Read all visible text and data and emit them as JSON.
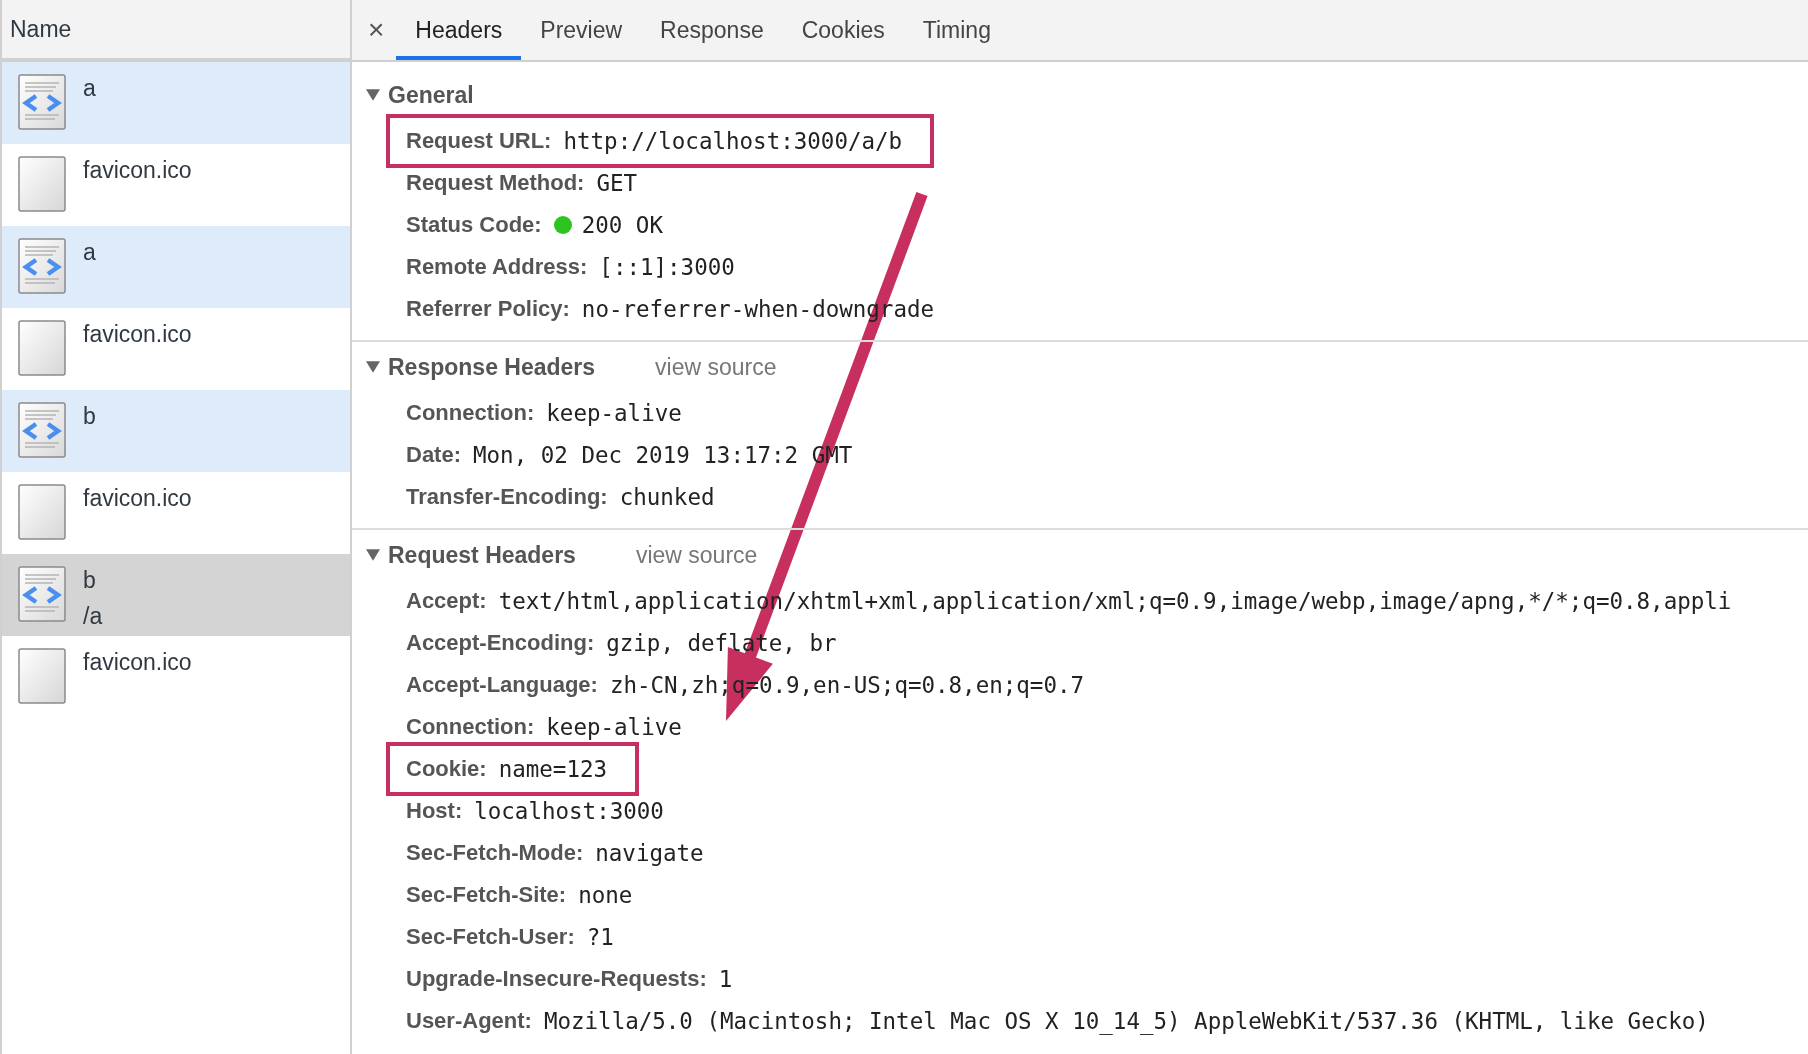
{
  "requests_list": {
    "header": "Name",
    "items": [
      {
        "kind": "document",
        "name": "a",
        "selected": false
      },
      {
        "kind": "file",
        "name": "favicon.ico",
        "selected": false
      },
      {
        "kind": "document",
        "name": "a",
        "selected": false
      },
      {
        "kind": "file",
        "name": "favicon.ico",
        "selected": false
      },
      {
        "kind": "document",
        "name": "b",
        "selected": false
      },
      {
        "kind": "file",
        "name": "favicon.ico",
        "selected": false
      },
      {
        "kind": "document",
        "name": "b",
        "path": "/a",
        "selected": true
      },
      {
        "kind": "file",
        "name": "favicon.ico",
        "selected": false
      }
    ]
  },
  "tabs": {
    "close": "×",
    "items": [
      {
        "label": "Headers",
        "selected": true
      },
      {
        "label": "Preview",
        "selected": false
      },
      {
        "label": "Response",
        "selected": false
      },
      {
        "label": "Cookies",
        "selected": false
      },
      {
        "label": "Timing",
        "selected": false
      }
    ]
  },
  "sections": [
    {
      "title": "General",
      "expanded": true,
      "rows": [
        {
          "name": "Request URL:",
          "value": "http://localhost:3000/a/b",
          "highlighted": true
        },
        {
          "name": "Request Method:",
          "value": "GET",
          "highlighted": false
        },
        {
          "name": "Status Code:",
          "value": "200 OK",
          "color": "#2ec41f",
          "highlighted": false
        },
        {
          "name": "Remote Address:",
          "value": "[::1]:3000",
          "highlighted": false
        },
        {
          "name": "Referrer Policy:",
          "value": "no-referrer-when-downgrade",
          "highlighted": false
        }
      ]
    },
    {
      "title": "Response Headers",
      "link": "view source",
      "expanded": true,
      "rows": [
        {
          "name": "Connection:",
          "value": "keep-alive",
          "highlighted": false
        },
        {
          "name": "Date:",
          "value": "Mon, 02 Dec 2019 13:17:2  GMT",
          "highlighted": false
        },
        {
          "name": "Transfer-Encoding:",
          "value": "chunked",
          "highlighted": false
        }
      ]
    },
    {
      "title": "Request Headers",
      "link": "view source",
      "expanded": true,
      "rows": [
        {
          "name": "Accept:",
          "value": "text/html,application/xhtml+xml,application/xml;q=0.9,image/webp,image/apng,*/*;q=0.8,appli",
          "highlighted": false
        },
        {
          "name": "Accept-Encoding:",
          "value": "gzip, deflate, br",
          "highlighted": false
        },
        {
          "name": "Accept-Language:",
          "value": "zh-CN,zh;q=0.9,en-US;q=0.8,en;q=0.7",
          "highlighted": false
        },
        {
          "name": "Connection:",
          "value": "keep-alive",
          "highlighted": false
        },
        {
          "name": "Cookie:",
          "value": "name=123",
          "highlighted": true
        },
        {
          "name": "Host:",
          "value": "localhost:3000",
          "highlighted": false
        },
        {
          "name": "Sec-Fetch-Mode:",
          "value": "navigate",
          "highlighted": false
        },
        {
          "name": "Sec-Fetch-Site:",
          "value": "none",
          "highlighted": false
        },
        {
          "name": "Sec-Fetch-User:",
          "value": "?1",
          "highlighted": false
        },
        {
          "name": "Upgrade-Insecure-Requests:",
          "value": "1",
          "highlighted": false
        },
        {
          "name": "User-Agent:",
          "value": "Mozilla/5.0 (Macintosh; Intel Mac OS X 10_14_5) AppleWebKit/537.36 (KHTML, like Gecko)",
          "highlighted": false
        }
      ]
    }
  ],
  "annotation": {
    "kind": "arrow"
  }
}
